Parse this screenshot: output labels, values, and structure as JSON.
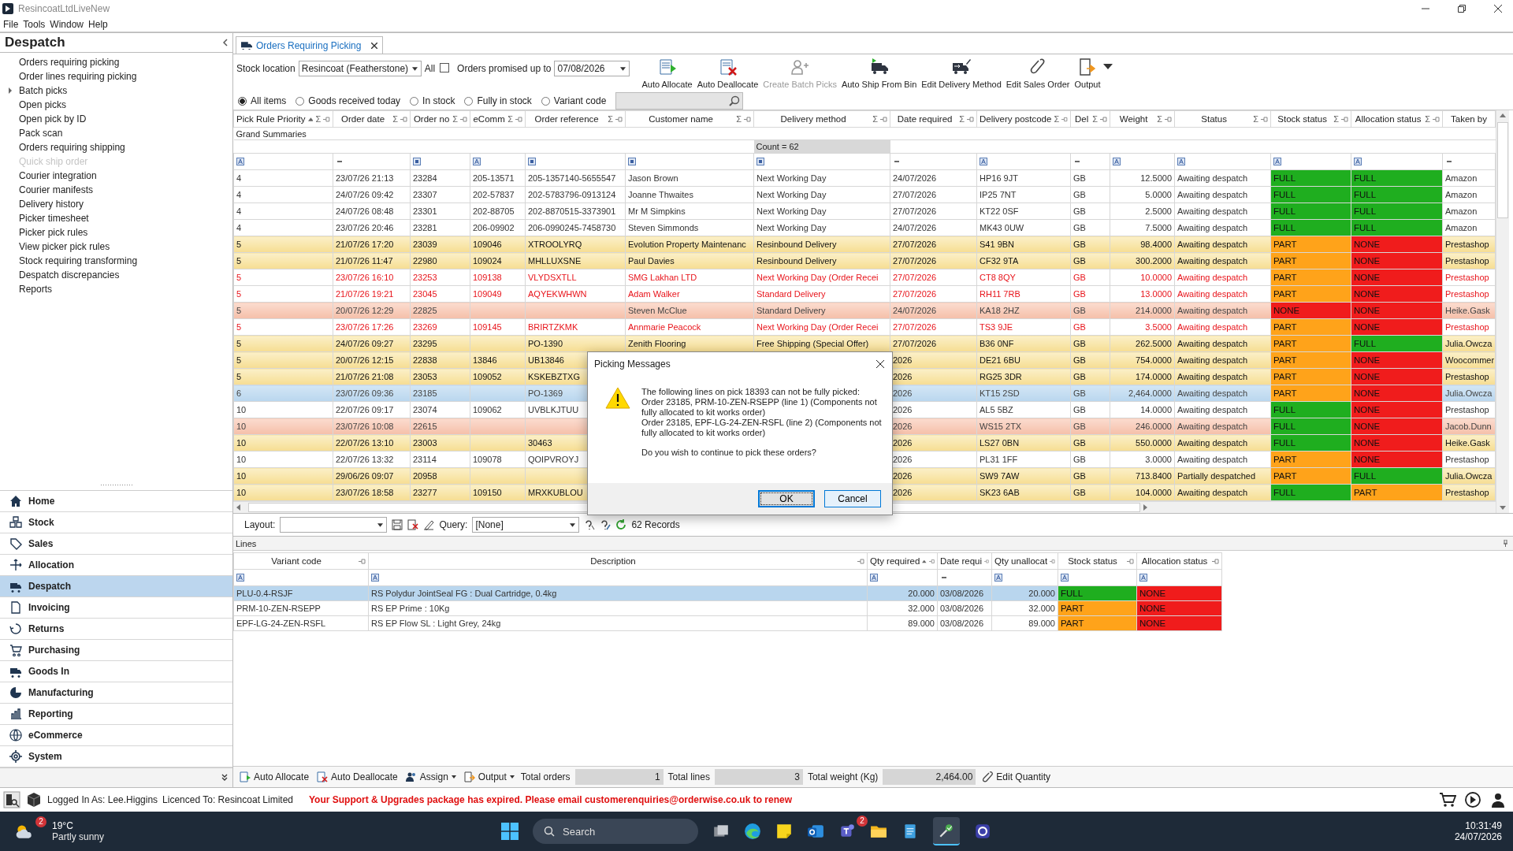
{
  "window": {
    "title": "ResincoatLtdLiveNew"
  },
  "menu": [
    "File",
    "Tools",
    "Window",
    "Help"
  ],
  "sidebar": {
    "title": "Despatch",
    "items": [
      {
        "label": "Orders requiring picking",
        "disabled": false
      },
      {
        "label": "Order lines requiring picking",
        "disabled": false
      },
      {
        "label": "Batch picks",
        "disabled": false,
        "expanded": false
      },
      {
        "label": "Open picks",
        "disabled": false
      },
      {
        "label": "Open pick by ID",
        "disabled": false
      },
      {
        "label": "Pack scan",
        "disabled": false
      },
      {
        "label": "Orders requiring shipping",
        "disabled": false
      },
      {
        "label": "Quick ship order",
        "disabled": true
      },
      {
        "label": "Courier integration",
        "disabled": false
      },
      {
        "label": "Courier manifests",
        "disabled": false
      },
      {
        "label": "Delivery history",
        "disabled": false
      },
      {
        "label": "Picker timesheet",
        "disabled": false
      },
      {
        "label": "Picker pick rules",
        "disabled": false
      },
      {
        "label": "View picker pick rules",
        "disabled": false
      },
      {
        "label": "Stock requiring transforming",
        "disabled": false
      },
      {
        "label": "Despatch discrepancies",
        "disabled": false
      },
      {
        "label": "Reports",
        "disabled": false
      }
    ],
    "modules": [
      {
        "label": "Home",
        "selected": false
      },
      {
        "label": "Stock",
        "selected": false
      },
      {
        "label": "Sales",
        "selected": false
      },
      {
        "label": "Allocation",
        "selected": false
      },
      {
        "label": "Despatch",
        "selected": true
      },
      {
        "label": "Invoicing",
        "selected": false
      },
      {
        "label": "Returns",
        "selected": false
      },
      {
        "label": "Purchasing",
        "selected": false
      },
      {
        "label": "Goods In",
        "selected": false
      },
      {
        "label": "Manufacturing",
        "selected": false
      },
      {
        "label": "Reporting",
        "selected": false
      },
      {
        "label": "eCommerce",
        "selected": false
      },
      {
        "label": "System",
        "selected": false
      }
    ]
  },
  "tab": {
    "label": "Orders Requiring Picking"
  },
  "filters": {
    "stock_location_label": "Stock location",
    "stock_location": "Resincoat (Featherstone)",
    "all_label": "All",
    "all_checked": false,
    "promised_label": "Orders promised up to",
    "promised_date": "07/08/2026",
    "radios": [
      {
        "label": "All items",
        "selected": true
      },
      {
        "label": "Goods received today",
        "selected": false
      },
      {
        "label": "In stock",
        "selected": false
      },
      {
        "label": "Fully in stock",
        "selected": false
      },
      {
        "label": "Variant code",
        "selected": false
      }
    ]
  },
  "toolbar": [
    {
      "label": "Auto Allocate",
      "disabled": false
    },
    {
      "label": "Auto Deallocate",
      "disabled": false
    },
    {
      "label": "Create Batch Picks",
      "disabled": true
    },
    {
      "label": "Auto Ship From Bin",
      "disabled": false
    },
    {
      "label": "Edit Delivery Method",
      "disabled": false
    },
    {
      "label": "Edit Sales Order",
      "disabled": false
    },
    {
      "label": "Output",
      "disabled": false,
      "menu": true
    }
  ],
  "grid": {
    "columns": [
      {
        "label": "Pick Rule Priority",
        "sigma": "Σ",
        "sorted": true,
        "kind": "text"
      },
      {
        "label": "Order date",
        "sigma": "Σ",
        "sorted": false,
        "kind": "dash"
      },
      {
        "label": "Order no",
        "sigma": "Σ",
        "sorted": false,
        "kind": "list"
      },
      {
        "label": "eComm",
        "sigma": "Σ",
        "sorted": false,
        "kind": "text"
      },
      {
        "label": "Order reference",
        "sigma": "Σ",
        "sorted": false,
        "kind": "list"
      },
      {
        "label": "Customer name",
        "sigma": "Σ",
        "sorted": false,
        "kind": "list"
      },
      {
        "label": "Delivery method",
        "sigma": "Σ",
        "sorted": false,
        "kind": "list"
      },
      {
        "label": "Date required",
        "sigma": "Σ",
        "sorted": false,
        "kind": "dash"
      },
      {
        "label": "Delivery postcode",
        "sigma": "Σ",
        "sorted": false,
        "kind": "text"
      },
      {
        "label": "Del",
        "sigma": "Σ",
        "sorted": false,
        "kind": "dash"
      },
      {
        "label": "Weight",
        "sigma": "Σ",
        "sorted": false,
        "kind": "text"
      },
      {
        "label": "Status",
        "sigma": "Σ",
        "sorted": false,
        "kind": "text"
      },
      {
        "label": "Stock status",
        "sigma": "Σ",
        "sorted": false,
        "kind": "text"
      },
      {
        "label": "Allocation status",
        "sigma": "Σ",
        "sorted": false,
        "kind": "text"
      },
      {
        "label": "Taken by",
        "sorted": false,
        "kind": "dash"
      }
    ],
    "summaries_label": "Grand Summaries",
    "count": "Count = 62",
    "rows": [
      {
        "kind": "plain",
        "selected": false,
        "priority": "4",
        "order_date": "23/07/26 21:13",
        "order_no": "23284",
        "ecomm": "205-13571",
        "reference": "205-1357140-5655547",
        "customer": "Jason Brown",
        "delivery": "Next Working Day",
        "date_required": "24/07/2026",
        "postcode": "HP16 9JT",
        "del": "GB",
        "weight": "12.5000",
        "status": "Awaiting despatch",
        "stock": {
          "text": "FULL",
          "color": "#1fae1f"
        },
        "allocation": {
          "text": "FULL",
          "color": "#1fae1f"
        },
        "taken_by": "Amazon"
      },
      {
        "kind": "plain",
        "selected": false,
        "priority": "4",
        "order_date": "24/07/26 09:42",
        "order_no": "23307",
        "ecomm": "202-57837",
        "reference": "202-5783796-0913124",
        "customer": "Joanne Thwaites",
        "delivery": "Next Working Day",
        "date_required": "27/07/2026",
        "postcode": "IP25 7NT",
        "del": "GB",
        "weight": "5.0000",
        "status": "Awaiting despatch",
        "stock": {
          "text": "FULL",
          "color": "#1fae1f"
        },
        "allocation": {
          "text": "FULL",
          "color": "#1fae1f"
        },
        "taken_by": "Amazon"
      },
      {
        "kind": "plain",
        "selected": false,
        "priority": "4",
        "order_date": "24/07/26 08:48",
        "order_no": "23301",
        "ecomm": "202-88705",
        "reference": "202-8870515-3373901",
        "customer": "Mr M Simpkins",
        "delivery": "Next Working Day",
        "date_required": "27/07/2026",
        "postcode": "KT22 0SF",
        "del": "GB",
        "weight": "2.5000",
        "status": "Awaiting despatch",
        "stock": {
          "text": "FULL",
          "color": "#1fae1f"
        },
        "allocation": {
          "text": "FULL",
          "color": "#1fae1f"
        },
        "taken_by": "Amazon"
      },
      {
        "kind": "plain",
        "selected": false,
        "priority": "4",
        "order_date": "23/07/26 20:46",
        "order_no": "23281",
        "ecomm": "206-09902",
        "reference": "206-0990245-7458730",
        "customer": "Steven Simmonds",
        "delivery": "Next Working Day",
        "date_required": "24/07/2026",
        "postcode": "MK43 0UW",
        "del": "GB",
        "weight": "7.5000",
        "status": "Awaiting despatch",
        "stock": {
          "text": "FULL",
          "color": "#1fae1f"
        },
        "allocation": {
          "text": "FULL",
          "color": "#1fae1f"
        },
        "taken_by": "Amazon"
      },
      {
        "kind": "amber",
        "selected": false,
        "priority": "5",
        "order_date": "21/07/26 17:20",
        "order_no": "23039",
        "ecomm": "109046",
        "reference": "XTROOLYRQ",
        "customer": "Evolution Property Maintenanc",
        "delivery": "Resinbound Delivery",
        "date_required": "27/07/2026",
        "postcode": "S41 9BN",
        "del": "GB",
        "weight": "98.4000",
        "status": "Awaiting despatch",
        "stock": {
          "text": "PART",
          "color": "#ffa31a"
        },
        "allocation": {
          "text": "NONE",
          "color": "#f01c1c"
        },
        "taken_by": "Prestashop"
      },
      {
        "kind": "amber",
        "selected": false,
        "priority": "5",
        "order_date": "21/07/26 11:47",
        "order_no": "22980",
        "ecomm": "109024",
        "reference": "MHLLUXSNE",
        "customer": "Paul Davies",
        "delivery": "Resinbound Delivery",
        "date_required": "27/07/2026",
        "postcode": "CF32 9TA",
        "del": "GB",
        "weight": "300.2000",
        "status": "Awaiting despatch",
        "stock": {
          "text": "PART",
          "color": "#ffa31a"
        },
        "allocation": {
          "text": "NONE",
          "color": "#f01c1c"
        },
        "taken_by": "Prestashop"
      },
      {
        "kind": "late",
        "selected": false,
        "priority": "5",
        "order_date": "23/07/26 16:10",
        "order_no": "23253",
        "ecomm": "109138",
        "reference": "VLYDSXTLL",
        "customer": "SMG Lakhan LTD",
        "delivery": "Next Working Day (Order Recei",
        "date_required": "27/07/2026",
        "postcode": "CT8 8QY",
        "del": "GB",
        "weight": "10.0000",
        "status": "Awaiting despatch",
        "stock": {
          "text": "PART",
          "color": "#ffa31a"
        },
        "allocation": {
          "text": "NONE",
          "color": "#f01c1c"
        },
        "taken_by": "Prestashop"
      },
      {
        "kind": "late",
        "selected": false,
        "priority": "5",
        "order_date": "21/07/26 19:21",
        "order_no": "23045",
        "ecomm": "109049",
        "reference": "AQYEKWHWN",
        "customer": "Adam Walker",
        "delivery": "Standard Delivery",
        "date_required": "27/07/2026",
        "postcode": "RH11 7RB",
        "del": "GB",
        "weight": "13.0000",
        "status": "Awaiting despatch",
        "stock": {
          "text": "PART",
          "color": "#ffa31a"
        },
        "allocation": {
          "text": "NONE",
          "color": "#f01c1c"
        },
        "taken_by": "Prestashop"
      },
      {
        "kind": "blocked",
        "selected": false,
        "priority": "5",
        "order_date": "20/07/26 12:29",
        "order_no": "22825",
        "customer": "Steven McClue",
        "delivery": "Standard Delivery",
        "date_required": "24/07/2026",
        "postcode": "KA18 2HZ",
        "del": "GB",
        "weight": "214.0000",
        "status": "Awaiting despatch",
        "stock": {
          "text": "NONE",
          "color": "#f01c1c"
        },
        "allocation": {
          "text": "NONE",
          "color": "#f01c1c"
        },
        "taken_by": "Heike.Gask"
      },
      {
        "kind": "late",
        "selected": false,
        "priority": "5",
        "order_date": "23/07/26 17:26",
        "order_no": "23269",
        "ecomm": "109145",
        "reference": "BRIRTZKMK",
        "customer": "Annmarie Peacock",
        "delivery": "Next Working Day (Order Recei",
        "date_required": "27/07/2026",
        "postcode": "TS3 9JE",
        "del": "GB",
        "weight": "3.5000",
        "status": "Awaiting despatch",
        "stock": {
          "text": "PART",
          "color": "#ffa31a"
        },
        "allocation": {
          "text": "NONE",
          "color": "#f01c1c"
        },
        "taken_by": "Prestashop"
      },
      {
        "kind": "amber",
        "selected": false,
        "priority": "5",
        "order_date": "24/07/26 09:27",
        "order_no": "23295",
        "reference": "PO-1390",
        "customer": "Zenith Flooring",
        "delivery": "Free Shipping (Special Offer)",
        "date_required": "27/07/2026",
        "postcode": "B36 0NF",
        "del": "GB",
        "weight": "262.5000",
        "status": "Awaiting despatch",
        "stock": {
          "text": "PART",
          "color": "#ffa31a"
        },
        "allocation": {
          "text": "FULL",
          "color": "#1fae1f"
        },
        "taken_by": "Julia.Owcza"
      },
      {
        "kind": "amber",
        "selected": false,
        "priority": "5",
        "order_date": "20/07/26 12:15",
        "order_no": "22838",
        "ecomm": "13846",
        "reference": "UB13846",
        "date_required": "2026",
        "postcode": "DE21 6BU",
        "del": "GB",
        "weight": "754.0000",
        "status": "Awaiting despatch",
        "stock": {
          "text": "PART",
          "color": "#ffa31a"
        },
        "allocation": {
          "text": "NONE",
          "color": "#f01c1c"
        },
        "taken_by": "Woocommer"
      },
      {
        "kind": "amber",
        "selected": false,
        "priority": "5",
        "order_date": "21/07/26 21:08",
        "order_no": "23053",
        "ecomm": "109052",
        "reference": "KSKEBZTXG",
        "date_required": "2026",
        "postcode": "RG25 3DR",
        "del": "GB",
        "weight": "174.0000",
        "status": "Awaiting despatch",
        "stock": {
          "text": "PART",
          "color": "#ffa31a"
        },
        "allocation": {
          "text": "NONE",
          "color": "#f01c1c"
        },
        "taken_by": "Prestashop"
      },
      {
        "kind": "amber",
        "selected": true,
        "priority": "6",
        "order_date": "23/07/26 09:36",
        "order_no": "23185",
        "reference": "PO-1369",
        "date_required": "2026",
        "postcode": "KT15 2SD",
        "del": "GB",
        "weight": "2,464.0000",
        "status": "Awaiting despatch",
        "stock": {
          "text": "PART",
          "color": "#ffa31a"
        },
        "allocation": {
          "text": "NONE",
          "color": "#f01c1c"
        },
        "taken_by": "Julia.Owcza"
      },
      {
        "kind": "plain",
        "selected": false,
        "priority": "10",
        "order_date": "22/07/26 09:17",
        "order_no": "23074",
        "ecomm": "109062",
        "reference": "UVBLKJTUU",
        "date_required": "2026",
        "postcode": "AL5 5BZ",
        "del": "GB",
        "weight": "14.0000",
        "status": "Awaiting despatch",
        "stock": {
          "text": "FULL",
          "color": "#1fae1f"
        },
        "allocation": {
          "text": "NONE",
          "color": "#f01c1c"
        },
        "taken_by": "Prestashop"
      },
      {
        "kind": "blocked",
        "selected": false,
        "priority": "10",
        "order_date": "23/07/26 10:08",
        "order_no": "22615",
        "date_required": "2026",
        "postcode": "WS15 2TX",
        "del": "GB",
        "weight": "246.0000",
        "status": "Awaiting despatch",
        "stock": {
          "text": "FULL",
          "color": "#1fae1f"
        },
        "allocation": {
          "text": "NONE",
          "color": "#f01c1c"
        },
        "taken_by": "Jacob.Dunn"
      },
      {
        "kind": "amber",
        "selected": false,
        "priority": "10",
        "order_date": "22/07/26 13:10",
        "order_no": "23003",
        "reference": "30463",
        "date_required": "2026",
        "postcode": "LS27 0BN",
        "del": "GB",
        "weight": "550.0000",
        "status": "Awaiting despatch",
        "stock": {
          "text": "FULL",
          "color": "#1fae1f"
        },
        "allocation": {
          "text": "NONE",
          "color": "#f01c1c"
        },
        "taken_by": "Heike.Gask"
      },
      {
        "kind": "plain",
        "selected": false,
        "priority": "10",
        "order_date": "22/07/26 13:32",
        "order_no": "23114",
        "ecomm": "109078",
        "reference": "QOIPVROYJ",
        "date_required": "2026",
        "postcode": "PL31 1FF",
        "del": "GB",
        "weight": "3.0000",
        "status": "Awaiting despatch",
        "stock": {
          "text": "PART",
          "color": "#ffa31a"
        },
        "allocation": {
          "text": "NONE",
          "color": "#f01c1c"
        },
        "taken_by": "Prestashop"
      },
      {
        "kind": "amber",
        "selected": false,
        "priority": "10",
        "order_date": "29/06/26 09:07",
        "order_no": "20958",
        "date_required": "2026",
        "postcode": "SW9 7AW",
        "del": "GB",
        "weight": "713.8400",
        "status": "Partially despatched",
        "stock": {
          "text": "PART",
          "color": "#ffa31a"
        },
        "allocation": {
          "text": "FULL",
          "color": "#1fae1f"
        },
        "taken_by": "Julia.Owcza"
      },
      {
        "kind": "amber",
        "selected": false,
        "priority": "10",
        "order_date": "23/07/26 18:58",
        "order_no": "23277",
        "ecomm": "109150",
        "reference": "MRXKUBLOU",
        "date_required": "2026",
        "postcode": "SK23 6AB",
        "del": "GB",
        "weight": "104.0000",
        "status": "Awaiting despatch",
        "stock": {
          "text": "FULL",
          "color": "#1fae1f"
        },
        "allocation": {
          "text": "PART",
          "color": "#ffa31a"
        },
        "taken_by": "Prestashop"
      }
    ]
  },
  "grid_footer": {
    "layout_label": "Layout:",
    "query_label": "Query:",
    "query": "[None]",
    "records": "62 Records"
  },
  "lines": {
    "title": "Lines",
    "columns": [
      {
        "label": "Variant code",
        "sorted": false,
        "kind": "text"
      },
      {
        "label": "Description",
        "sorted": false,
        "kind": "text"
      },
      {
        "label": "Qty required",
        "sorted": true,
        "kind": "text"
      },
      {
        "label": "Date requi",
        "sorted": false,
        "kind": "dash"
      },
      {
        "label": "Qty unallocat",
        "sorted": false,
        "kind": "text"
      },
      {
        "label": "Stock status",
        "sorted": false,
        "kind": "text"
      },
      {
        "label": "Allocation status",
        "sorted": false,
        "kind": "text"
      }
    ],
    "rows": [
      {
        "selected": true,
        "variant": "PLU-0.4-RSJF",
        "description": "RS Polydur JointSeal FG : Dual Cartridge, 0.4kg",
        "qty_required": "20.000",
        "date": "03/08/2026",
        "qty_unallocated": "20.000",
        "stock": {
          "text": "FULL",
          "color": "#1fae1f"
        },
        "allocation": {
          "text": "NONE",
          "color": "#f01c1c"
        }
      },
      {
        "selected": false,
        "variant": "PRM-10-ZEN-RSEPP",
        "description": "RS EP Prime : 10Kg",
        "qty_required": "32.000",
        "date": "03/08/2026",
        "qty_unallocated": "32.000",
        "stock": {
          "text": "PART",
          "color": "#ffa31a"
        },
        "allocation": {
          "text": "NONE",
          "color": "#f01c1c"
        }
      },
      {
        "selected": false,
        "variant": "EPF-LG-24-ZEN-RSFL",
        "description": "RS EP Flow SL :  Light Grey, 24kg",
        "qty_required": "89.000",
        "date": "03/08/2026",
        "qty_unallocated": "89.000",
        "stock": {
          "text": "PART",
          "color": "#ffa31a"
        },
        "allocation": {
          "text": "NONE",
          "color": "#f01c1c"
        }
      }
    ]
  },
  "bottom_toolbar": {
    "buttons": [
      {
        "label": "Auto Allocate",
        "menu": false
      },
      {
        "label": "Auto Deallocate",
        "menu": false
      },
      {
        "label": "Assign",
        "menu": true
      },
      {
        "label": "Output",
        "menu": true
      }
    ],
    "totals": [
      {
        "label": "Total orders",
        "value": "1"
      },
      {
        "label": "Total lines",
        "value": "3"
      },
      {
        "label": "Total weight (Kg)",
        "value": "2,464.00"
      }
    ],
    "edit_button": "Edit Quantity"
  },
  "status_bar": {
    "logged_in": "Logged In As: Lee.Higgins",
    "licence": "Licenced To: Resincoat Limited",
    "message": "Your Support & Upgrades package has expired. Please email customerenquiries@orderwise.co.uk to renew"
  },
  "dialog": {
    "title": "Picking Messages",
    "message": "The following lines on pick 18393 can not be fully picked:\nOrder 23185, PRM-10-ZEN-RSEPP (line 1) (Components not fully allocated to kit works order)\nOrder 23185, EPF-LG-24-ZEN-RSFL (line 2) (Components not fully allocated to kit works order)",
    "question": "Do you wish to continue to pick these orders?",
    "buttons": [
      {
        "label": "OK",
        "focused": true
      },
      {
        "label": "Cancel",
        "focused": false
      }
    ]
  },
  "taskbar": {
    "weather_badge": "2",
    "temperature": "19°C",
    "weather": "Partly sunny",
    "search": "Search",
    "teams_badge": "2",
    "time": "10:31:49",
    "date": "24/07/2026"
  }
}
